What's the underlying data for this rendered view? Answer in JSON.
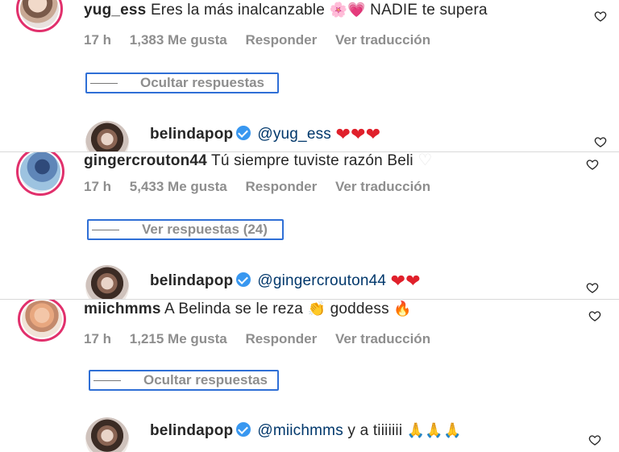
{
  "comments": [
    {
      "username": "yug_ess",
      "text": "Eres la más inalcanzable",
      "emojis": "🌸💗",
      "text_after": "NADIE te supera",
      "time": "17 h",
      "likes": "1,383 Me gusta",
      "reply": "Responder",
      "translate": "Ver traducción",
      "replies_toggle": "Ocultar respuestas",
      "reply_item": {
        "username": "belindapop",
        "mention": "@yug_ess",
        "text": "",
        "emojis": "❤❤❤"
      }
    },
    {
      "username": "gingercrouton44",
      "text": "Tú siempre tuviste razón Beli",
      "emojis": "♡",
      "time": "17 h",
      "likes": "5,433 Me gusta",
      "reply": "Responder",
      "translate": "Ver traducción",
      "replies_toggle": "Ver respuestas (24)",
      "reply_item": {
        "username": "belindapop",
        "mention": "@gingercrouton44",
        "text": "",
        "emojis": "❤❤"
      }
    },
    {
      "username": "miichmms",
      "text": "A Belinda se le reza",
      "emojis": "👏",
      "text_after": "goddess",
      "emoji_after": "🔥",
      "time": "17 h",
      "likes": "1,215 Me gusta",
      "reply": "Responder",
      "translate": "Ver traducción",
      "replies_toggle": "Ocultar respuestas",
      "reply_item": {
        "username": "belindapop",
        "mention": "@miichmms",
        "text": "y a tiiiiiii",
        "emojis": "🙏🙏🙏"
      }
    }
  ],
  "icons": {
    "like": "heart-outline-icon",
    "verified": "verified-badge-icon"
  },
  "colors": {
    "highlight_box": "#2f6fd6",
    "mention": "#00376b",
    "secondary_text": "#8e8e8e",
    "verified": "#3897f0"
  }
}
